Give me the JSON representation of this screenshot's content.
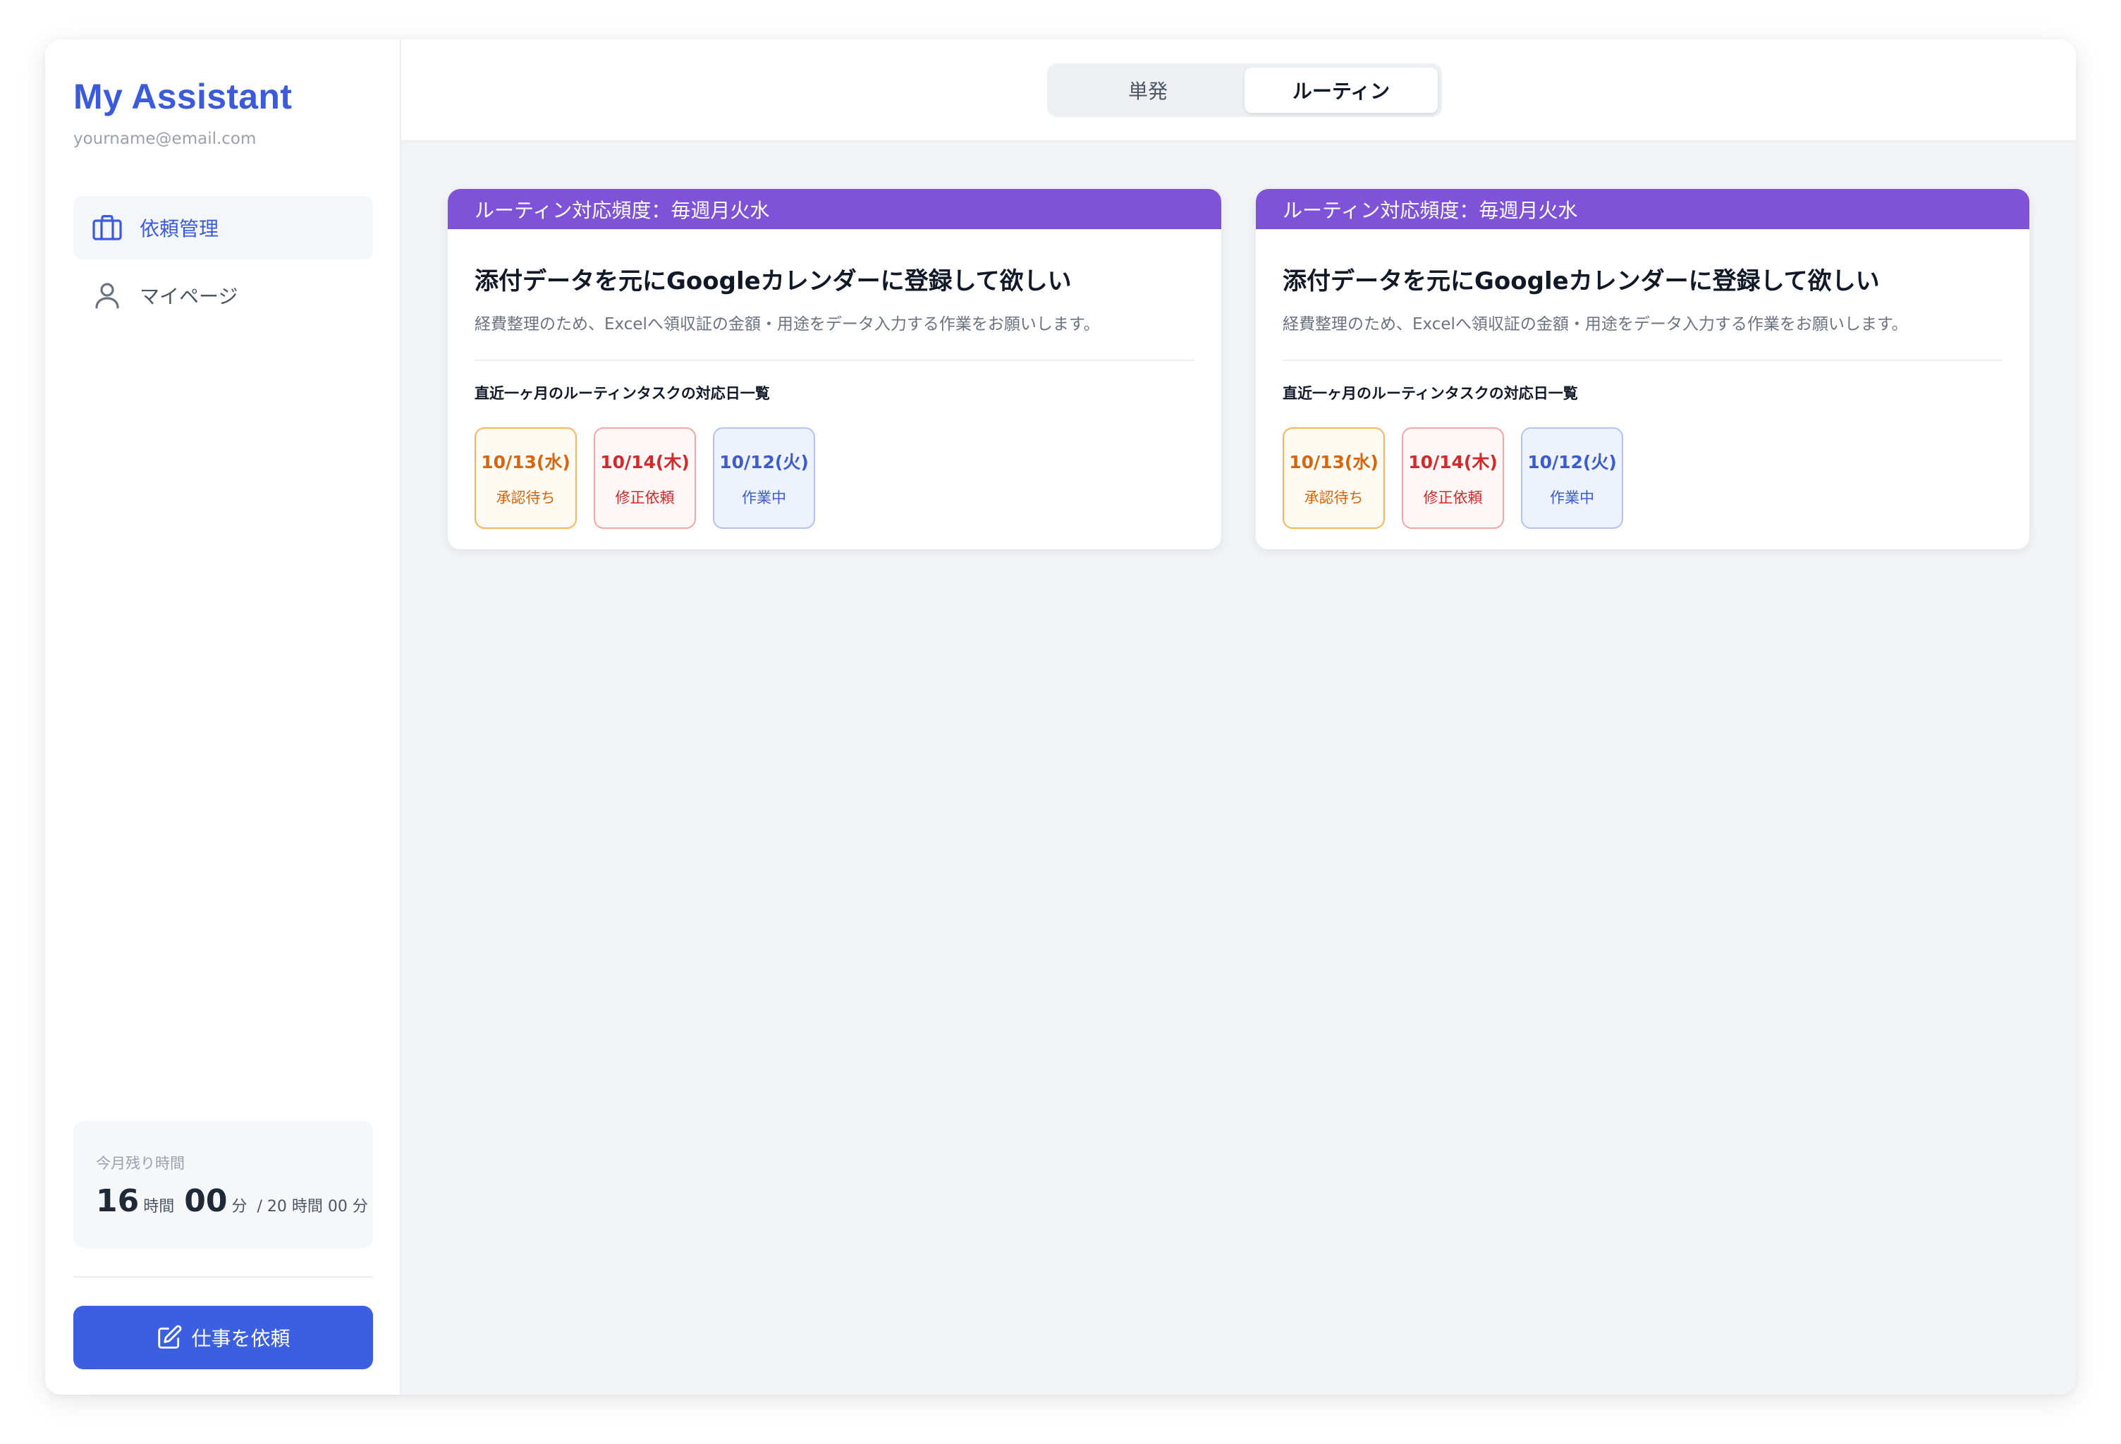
{
  "sidebar": {
    "brand_title": "My Assistant",
    "email": "yourname@email.com",
    "nav": [
      {
        "label": "依頼管理",
        "icon": "briefcase-icon",
        "active": true
      },
      {
        "label": "マイページ",
        "icon": "user-icon",
        "active": false
      }
    ],
    "time": {
      "caption": "今月残り時間",
      "hours": "16",
      "hours_unit": "時間",
      "minutes": "00",
      "minutes_unit": "分",
      "total": "/ 20 時間 00 分"
    },
    "request_button": {
      "label": "仕事を依頼",
      "icon": "edit-icon"
    }
  },
  "tabs": [
    {
      "label": "単発",
      "active": false
    },
    {
      "label": "ルーティン",
      "active": true
    }
  ],
  "cards": [
    {
      "band": "ルーティン対応頻度：毎週月火水",
      "title": "添付データを元にGoogleカレンダーに登録して欲しい",
      "description": "経費整理のため、Excelへ領収証の金額・用途をデータ入力する作業をお願いします。",
      "subheading": "直近一ヶ月のルーティンタスクの対応日一覧",
      "chips": [
        {
          "date": "10/13(水)",
          "status": "承認待ち",
          "kind": "pending"
        },
        {
          "date": "10/14(木)",
          "status": "修正依頼",
          "kind": "revision"
        },
        {
          "date": "10/12(火)",
          "status": "作業中",
          "kind": "working"
        }
      ]
    },
    {
      "band": "ルーティン対応頻度：毎週月火水",
      "title": "添付データを元にGoogleカレンダーに登録して欲しい",
      "description": "経費整理のため、Excelへ領収証の金額・用途をデータ入力する作業をお願いします。",
      "subheading": "直近一ヶ月のルーティンタスクの対応日一覧",
      "chips": [
        {
          "date": "10/13(水)",
          "status": "承認待ち",
          "kind": "pending"
        },
        {
          "date": "10/14(木)",
          "status": "修正依頼",
          "kind": "revision"
        },
        {
          "date": "10/12(火)",
          "status": "作業中",
          "kind": "working"
        }
      ]
    }
  ],
  "colors": {
    "brand": "#3b5bdb",
    "band": "#7e53d8",
    "pending": "#d9650b",
    "revision": "#d02a2a",
    "working": "#3a5ccf",
    "button": "#3b5fe0"
  }
}
